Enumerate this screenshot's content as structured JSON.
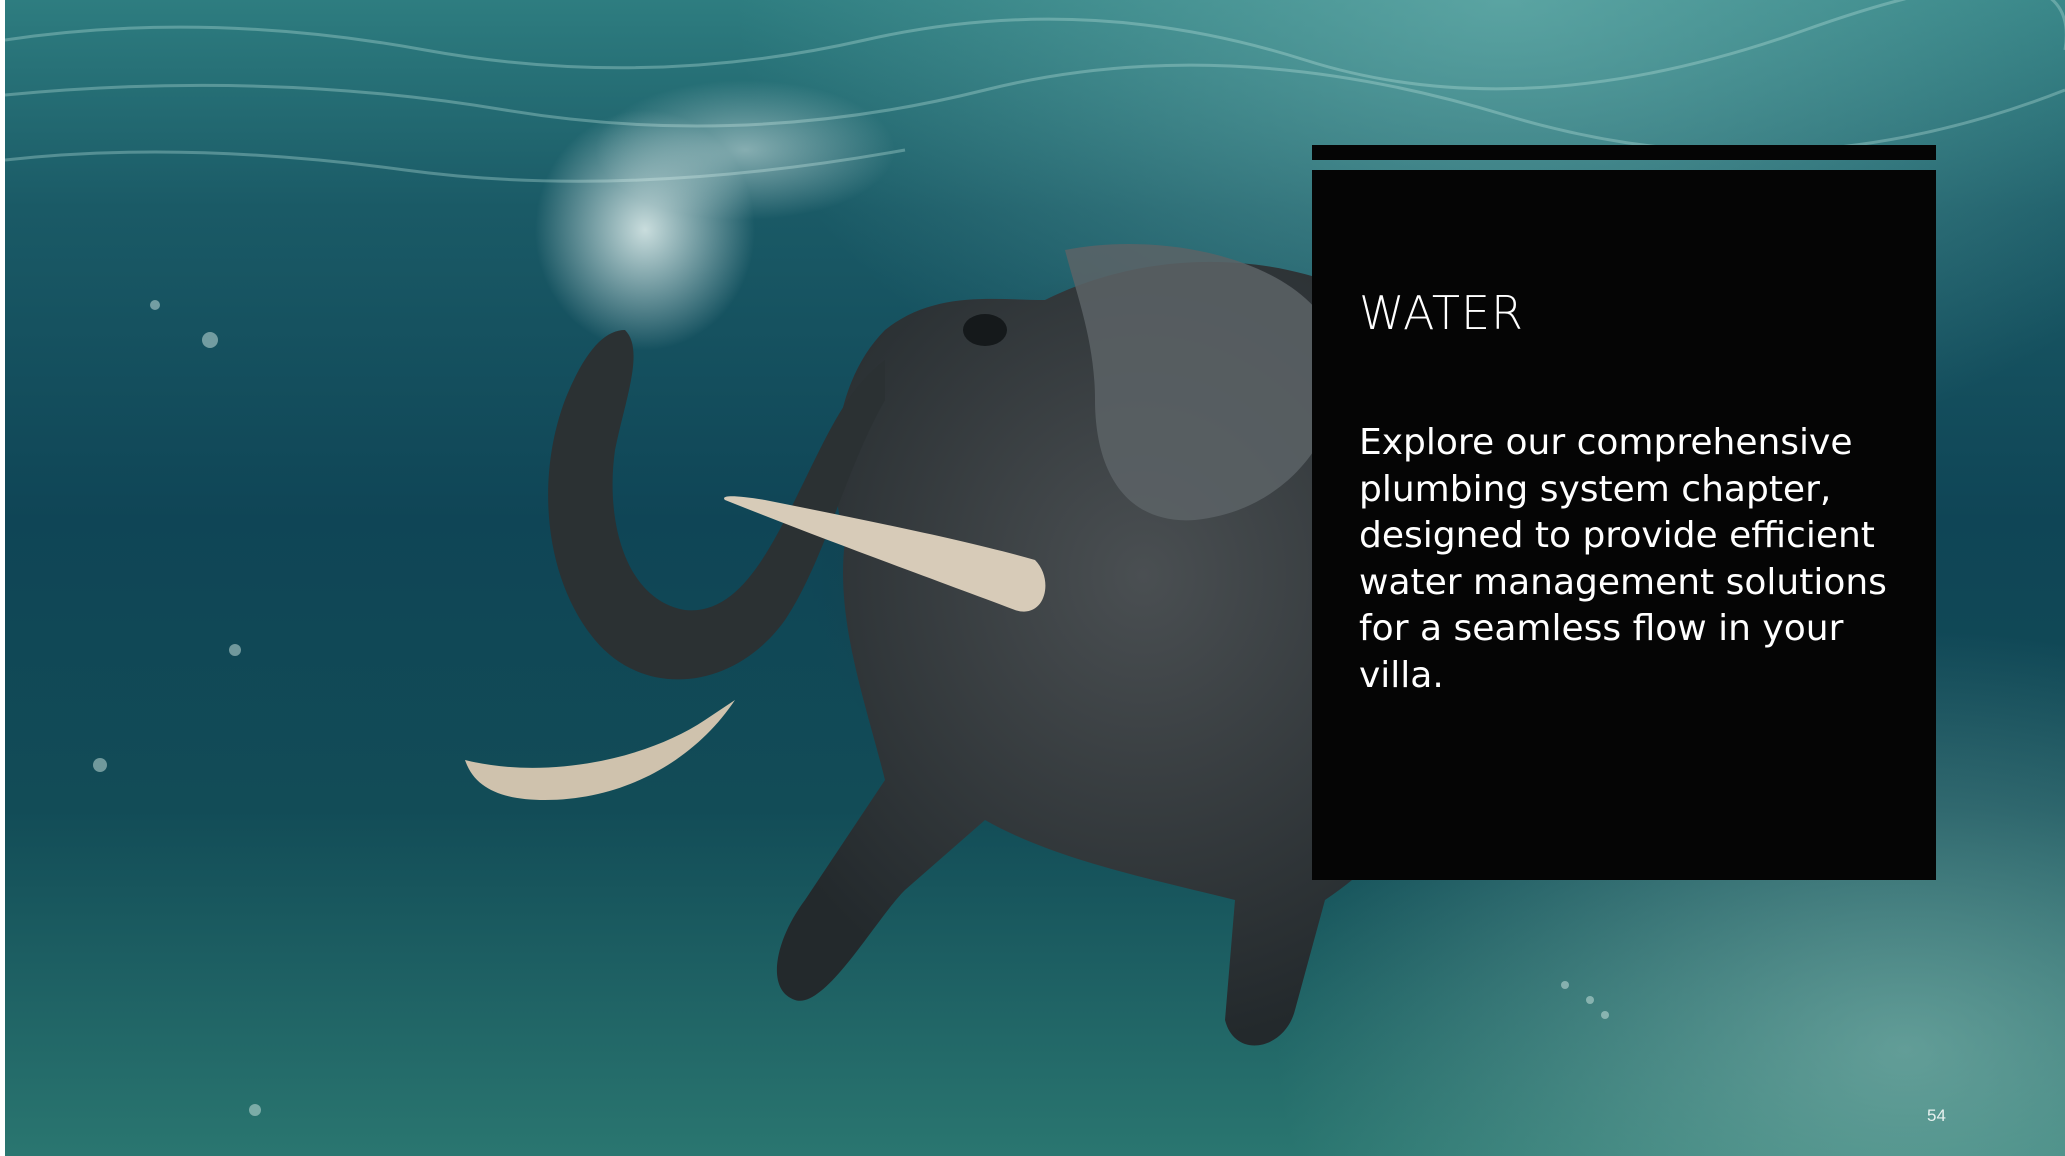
{
  "slide": {
    "background_image": "underwater-swimming-elephant-photo",
    "colors": {
      "panel": "#050505",
      "text": "#ffffff",
      "water_deep": "#0f4556",
      "water_light": "#2a7670"
    }
  },
  "info_panel": {
    "title": "WATER",
    "body": "Explore our comprehensive plumbing system chapter, designed to provide efficient water management solutions for a seamless flow in your villa."
  },
  "page_number": "54"
}
